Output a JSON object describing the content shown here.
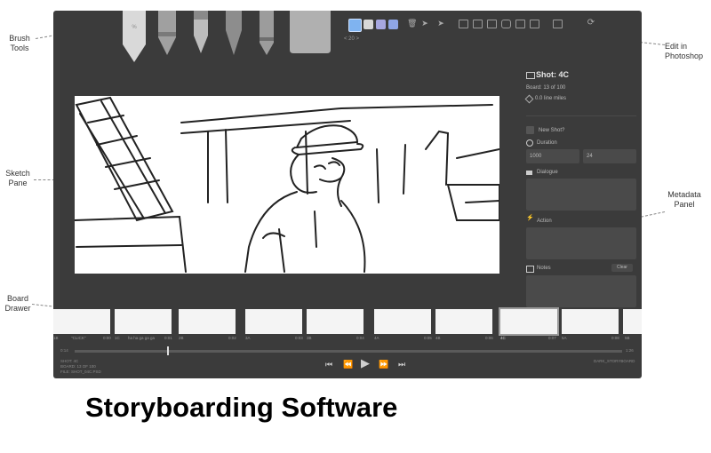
{
  "callouts": {
    "brush_tools": "Brush Tools",
    "sketch_pane": "Sketch Pane",
    "board_drawer": "Board Drawer",
    "edit_in_photoshop": "Edit in Photoshop",
    "metadata_panel": "Metadata Panel"
  },
  "toolbar": {
    "brush_size": "< 20 >",
    "swatches": [
      "#7fb3f0",
      "#d8d8d8",
      "#a7a7e0",
      "#8fa6e6"
    ]
  },
  "meta": {
    "shot_title": "Shot: 4C",
    "board_index": "Board: 13 of 100",
    "line_miles": "0.0 line miles",
    "new_shot_label": "New Shot?",
    "duration_label": "Duration",
    "duration_ms": "1000",
    "duration_frames": "24",
    "dialogue_label": "Dialogue",
    "action_label": "Action",
    "notes_label": "Notes",
    "clear_label": "Clear"
  },
  "drawer": {
    "thumbs": [
      {
        "label": "1B",
        "note": "\"CLICK\"",
        "time": "0:00"
      },
      {
        "label": "1C",
        "note": "ha ha ga ga ga",
        "time": "0:01"
      },
      {
        "label": "2B",
        "note": "",
        "time": "0:02"
      },
      {
        "label": "3A",
        "note": "",
        "time": "0:03"
      },
      {
        "label": "3B",
        "note": "",
        "time": "0:04"
      },
      {
        "label": "4A",
        "note": "",
        "time": "0:05"
      },
      {
        "label": "4B",
        "note": "",
        "time": "0:06"
      },
      {
        "label": "4C",
        "note": "",
        "time": "0:07"
      },
      {
        "label": "5A",
        "note": "",
        "time": "0:08"
      },
      {
        "label": "5B",
        "note": "",
        "time": "0:09"
      }
    ]
  },
  "timeline": {
    "start": "0:14",
    "end": "1:26",
    "info_lines": [
      "SHOT: 4C",
      "BOARD: 13 OF 100",
      "FILE: SHOT_04C.PSD"
    ],
    "project": "DARK_STORYBOARD"
  },
  "caption": "Storyboarding Software"
}
